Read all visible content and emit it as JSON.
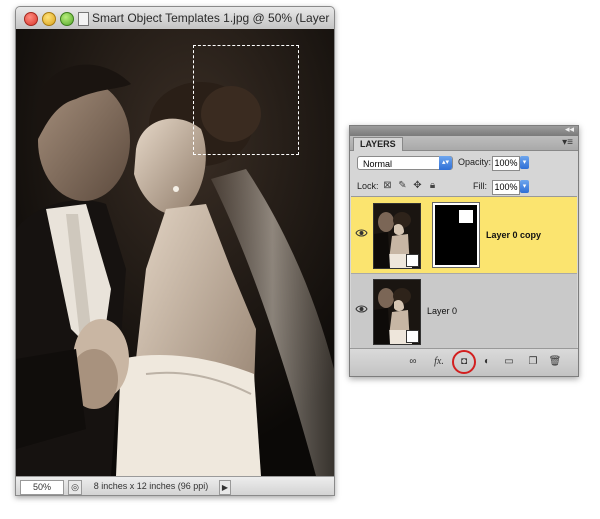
{
  "document": {
    "title": "Smart Object Templates 1.jpg @ 50% (Layer ...",
    "zoom": "50%",
    "doc_info": "8 inches x 12 inches (96 ppi)",
    "status_arrow": "▶"
  },
  "layers_panel": {
    "tab_label": "LAYERS",
    "menu_icon": "▾≡",
    "collapse_icon": "◂◂",
    "blend_mode": "Normal",
    "opacity_label": "Opacity:",
    "opacity_value": "100%",
    "lock_label": "Lock:",
    "fill_label": "Fill:",
    "fill_value": "100%",
    "layers": [
      {
        "name": "Layer 0 copy",
        "selected": true,
        "has_mask": true
      },
      {
        "name": "Layer 0",
        "selected": false,
        "has_mask": false
      }
    ],
    "footer_icons": [
      "link-icon",
      "fx-icon",
      "add-mask-icon",
      "adjustment-layer-icon",
      "group-folder-icon",
      "new-layer-icon",
      "trash-icon"
    ],
    "highlight_color": "#fbe46f",
    "annotation_circle_color": "#d21f1f"
  }
}
